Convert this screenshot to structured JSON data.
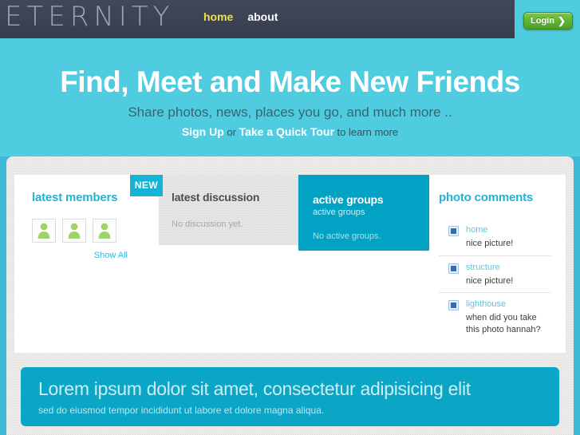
{
  "header": {
    "logo": "ETERNITY",
    "nav": [
      {
        "label": "home",
        "active": true
      },
      {
        "label": "about",
        "active": false
      }
    ],
    "login_label": "Login",
    "login_chevron": "❯"
  },
  "hero": {
    "headline": "Find, Meet and Make New Friends",
    "tagline": "Share photos, news, places you go, and much more ..",
    "cta_signup": "Sign Up",
    "cta_or": " or ",
    "cta_tour": "Take a Quick Tour",
    "cta_suffix": " to learn more"
  },
  "widgets": {
    "members": {
      "title": "latest members",
      "badge": "NEW",
      "show_all": "Show All",
      "avatar_count": 3
    },
    "discussion": {
      "title": "latest discussion",
      "empty": "No discussion yet."
    },
    "groups": {
      "title": "active groups",
      "subtitle": "active groups",
      "empty": "No active groups."
    },
    "photo_comments": {
      "title": "photo comments",
      "items": [
        {
          "photo": "home",
          "text": "nice picture!"
        },
        {
          "photo": "structure",
          "text": "nice picture!"
        },
        {
          "photo": "lighthouse",
          "text": "when did you take this photo hannah?"
        }
      ]
    }
  },
  "banner": {
    "headline": "Lorem ipsum dolor sit amet, consectetur adipisicing elit",
    "subtext": "sed do eiusmod tempor incididunt ut labore et dolore magna aliqua."
  },
  "colors": {
    "nav_bg": "#3b4252",
    "hero_cyan": "#4fcce0",
    "body_cyan": "#3cb9d6",
    "accent_cyan": "#22b2d4",
    "groups_teal": "#01a2c4",
    "banner_teal": "#0ba5c6",
    "login_green": "#6abf3b",
    "active_nav": "#f3e04a"
  }
}
